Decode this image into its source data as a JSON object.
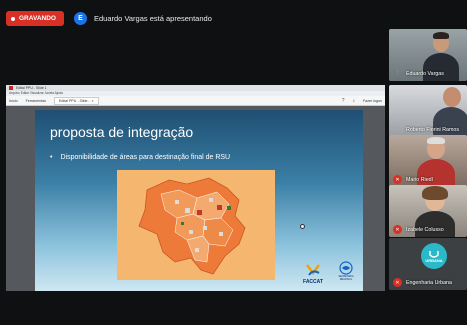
{
  "meeting": {
    "recording_label": "GRAVANDO",
    "presenter_initial": "E",
    "presenter_text": "Eduardo Vargas está apresentando"
  },
  "shared_window": {
    "title": "Edital PPU - Slide 1",
    "menu": "Arquivo  Editar  Visualizar  Janela  Ajuda",
    "toolbar_items": [
      "Início",
      "Ferramentas"
    ],
    "tab_label": "Edital PPU - Slide... ×",
    "user_label": "Fazer logon"
  },
  "slide": {
    "title": "proposta de integração",
    "bullet": "Disponibilidade de áreas para destinação final de RSU",
    "logo_faccat": "FACCAT",
    "logo_sec": "SECRETARIA REGIONAL"
  },
  "participants": [
    {
      "name": "Eduardo Vargas",
      "mic": "active"
    },
    {
      "name": "Roberto Fiorini Ramos",
      "mic": "none"
    },
    {
      "name": "Mario Riedl",
      "mic": "muted"
    },
    {
      "name": "Izabele Colusso",
      "mic": "muted"
    },
    {
      "name": "Engenharia Urbana",
      "mic": "muted",
      "logo": "URBANA"
    }
  ],
  "colors": {
    "recording": "#d93025",
    "presenter_avatar": "#1a73e8",
    "map_fill": "#f5b66f",
    "urbana_logo": "#2bb9c9"
  }
}
